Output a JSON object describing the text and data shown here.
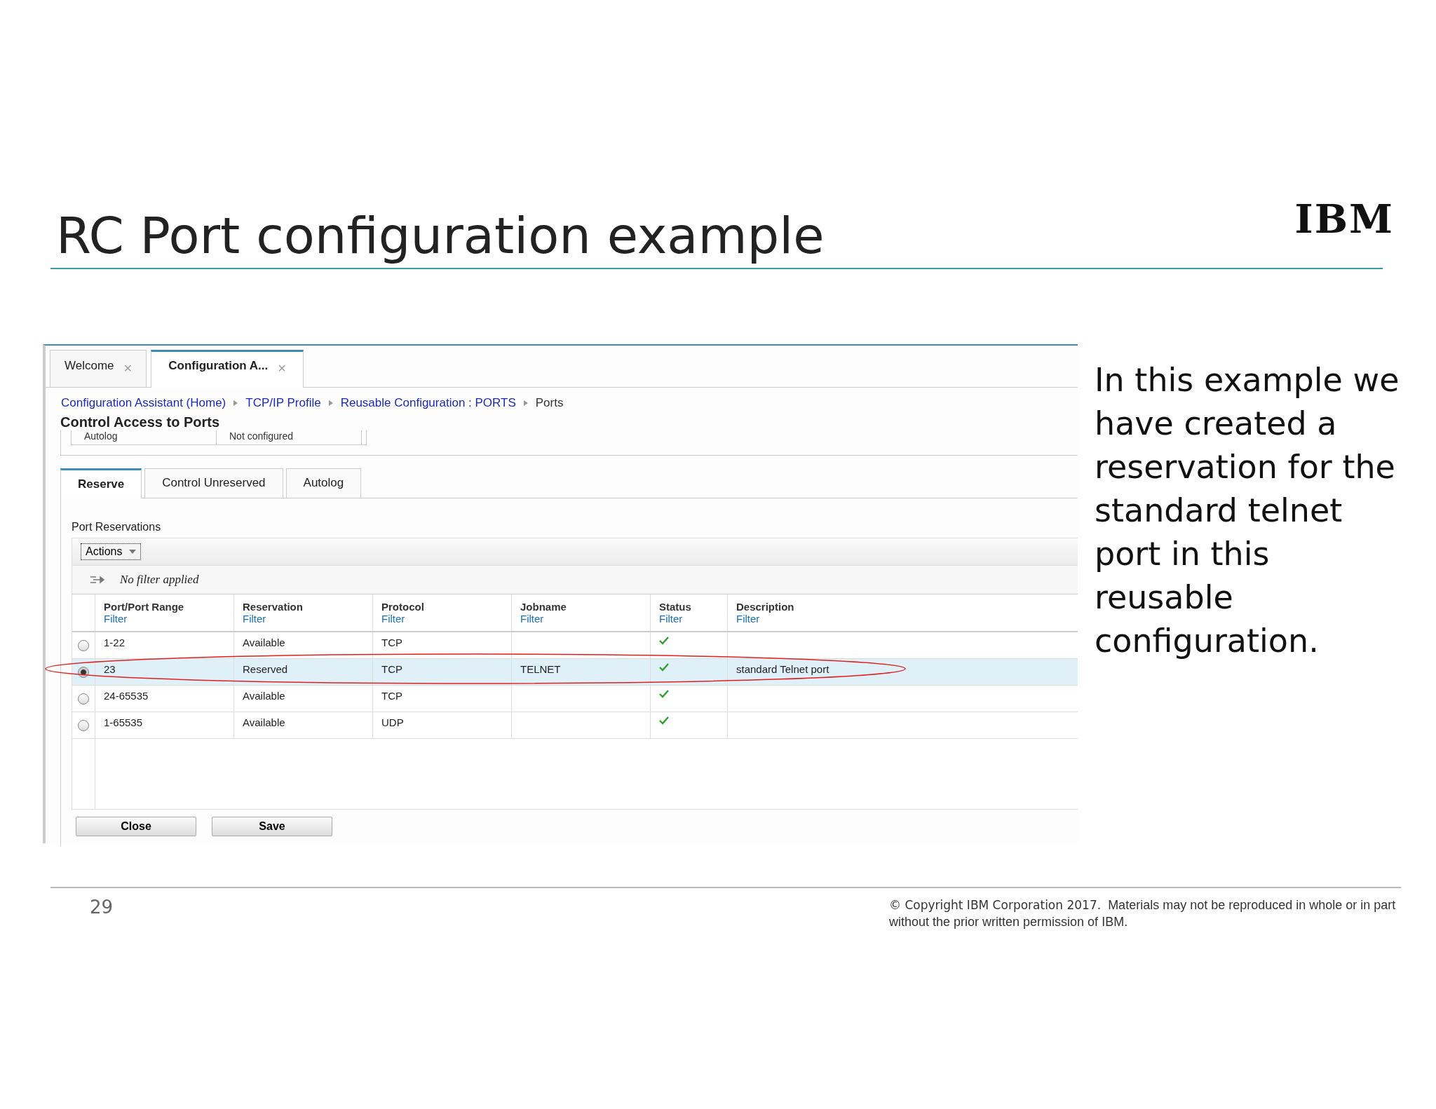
{
  "slide": {
    "title": "RC Port configuration example",
    "logo": "IBM"
  },
  "app": {
    "tabs": [
      {
        "label": "Welcome",
        "close": "×",
        "selected": false
      },
      {
        "label": "Configuration A...",
        "close": "×",
        "selected": true
      }
    ],
    "breadcrumb": [
      {
        "label": "Configuration Assistant (Home)",
        "kind": "link"
      },
      {
        "label": "TCP/IP Profile",
        "kind": "link"
      },
      {
        "label": "Reusable Configuration : PORTS",
        "kind": "link"
      },
      {
        "label": "Ports",
        "kind": "current"
      }
    ],
    "heading": "Control Access to Ports",
    "summary_row": [
      "Autolog",
      "Not configured"
    ],
    "subtabs": [
      {
        "label": "Reserve",
        "selected": true
      },
      {
        "label": "Control Unreserved",
        "selected": false
      },
      {
        "label": "Autolog",
        "selected": false
      }
    ],
    "section_label": "Port Reservations",
    "actions_button": "Actions",
    "filter_status": "No filter applied",
    "table": {
      "columns": [
        {
          "title": "Port/Port Range",
          "filter": "Filter"
        },
        {
          "title": "Reservation",
          "filter": "Filter"
        },
        {
          "title": "Protocol",
          "filter": "Filter"
        },
        {
          "title": "Jobname",
          "filter": "Filter"
        },
        {
          "title": "Status",
          "filter": "Filter"
        },
        {
          "title": "Description",
          "filter": "Filter"
        }
      ],
      "rows": [
        {
          "selected": false,
          "port": "1-22",
          "reservation": "Available",
          "protocol": "TCP",
          "jobname": "",
          "status_ok": true,
          "description": ""
        },
        {
          "selected": true,
          "port": "23",
          "reservation": "Reserved",
          "protocol": "TCP",
          "jobname": "TELNET",
          "status_ok": true,
          "description": "standard Telnet port"
        },
        {
          "selected": false,
          "port": "24-65535",
          "reservation": "Available",
          "protocol": "TCP",
          "jobname": "",
          "status_ok": true,
          "description": ""
        },
        {
          "selected": false,
          "port": "1-65535",
          "reservation": "Available",
          "protocol": "UDP",
          "jobname": "",
          "status_ok": true,
          "description": ""
        }
      ]
    },
    "buttons": [
      "Close",
      "Save"
    ]
  },
  "side_text": "In this example we have created a reservation for the standard telnet port in this reusable configuration.",
  "footer": {
    "page_number": "29",
    "copyright_lead": "© Copyright IBM Corporation 2017.",
    "copyright_rest": "Materials may not be reproduced in whole or in part without the prior written permission of IBM."
  }
}
